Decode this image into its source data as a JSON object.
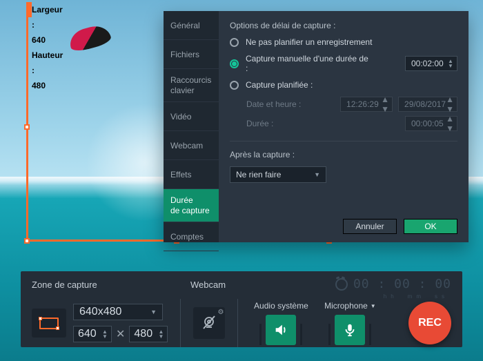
{
  "capture_frame": {
    "label": "Largeur : 640  Hauteur : 480"
  },
  "dialog": {
    "tabs": {
      "general": "Général",
      "files": "Fichiers",
      "shortcuts": "Raccourcis\nclavier",
      "video": "Vidéo",
      "webcam": "Webcam",
      "effects": "Effets",
      "duration": "Durée\nde capture",
      "accounts": "Comptes"
    },
    "panel": {
      "delay_title": "Options de délai de capture :",
      "opt_none": "Ne pas planifier un enregistrement",
      "opt_manual": "Capture manuelle d'une durée de :",
      "manual_value": "00:02:00",
      "opt_scheduled": "Capture planifiée :",
      "sched_datetime_label": "Date et heure :",
      "sched_time_value": "12:26:29",
      "sched_date_value": "29/08/2017",
      "sched_duration_label": "Durée :",
      "sched_duration_value": "00:00:05",
      "after_title": "Après la capture :",
      "after_value": "Ne rien faire",
      "cancel": "Annuler",
      "ok": "OK"
    }
  },
  "toolbar": {
    "zone_label": "Zone de capture",
    "preset": "640x480",
    "width": "640",
    "height": "480",
    "webcam_label": "Webcam",
    "sys_audio_label": "Audio système",
    "mic_label": "Microphone",
    "timer_digits": "00 : 00 : 00",
    "timer_hh": "hh",
    "timer_mm": "mm",
    "timer_ss": "ss",
    "rec": "REC"
  }
}
